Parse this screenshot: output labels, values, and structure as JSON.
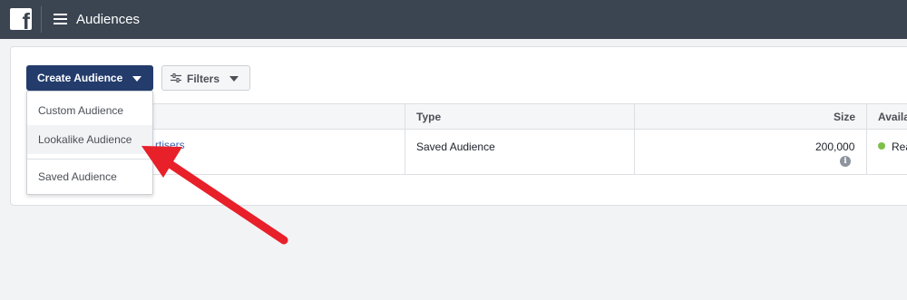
{
  "topbar": {
    "logo_letter": "f",
    "title": "Audiences"
  },
  "toolbar": {
    "create_label": "Create Audience",
    "filters_label": "Filters"
  },
  "dropdown": {
    "items": [
      {
        "label": "Custom Audience"
      },
      {
        "label": "Lookalike Audience",
        "highlighted": true
      },
      {
        "label": "Saved Audience"
      }
    ]
  },
  "table": {
    "columns": [
      "Type",
      "Size",
      "Availa"
    ],
    "rows": [
      {
        "name_partial": "rtisers",
        "type": "Saved Audience",
        "size": "200,000",
        "availability_partial": "Rea"
      }
    ]
  },
  "colors": {
    "topbar": "#3b4451",
    "primary_button": "#233c6c",
    "link": "#4267b2",
    "status_ready": "#7dbf4a",
    "annotation_arrow": "#e8202a"
  },
  "icons": {
    "logo": "facebook-logo-icon",
    "menu": "hamburger-menu-icon",
    "filters": "sliders-icon",
    "info": "info-icon",
    "annotation": "red-pointer-arrow"
  }
}
